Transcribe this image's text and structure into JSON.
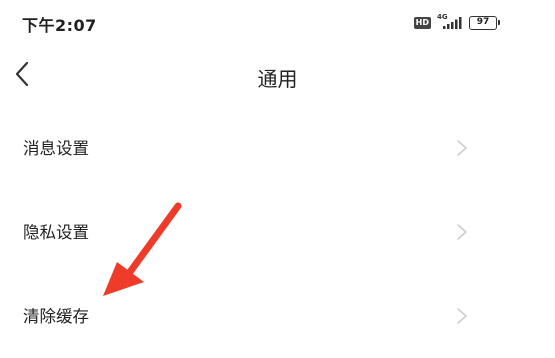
{
  "status_bar": {
    "time": "下午2:07",
    "hd_badge": "HD",
    "network_type": "4G",
    "battery_level": "97",
    "icons": [
      "hd-icon",
      "signal-icon",
      "battery-icon"
    ]
  },
  "nav": {
    "title": "通用",
    "back_icon": "chevron-left-icon"
  },
  "menu": {
    "items": [
      {
        "label": "消息设置",
        "icon": "chevron-right-icon"
      },
      {
        "label": "隐私设置",
        "icon": "chevron-right-icon"
      },
      {
        "label": "清除缓存",
        "icon": "chevron-right-icon"
      }
    ]
  },
  "annotation": {
    "icon": "arrow-pointer-icon",
    "color": "#ee3b2a"
  },
  "colors": {
    "background": "#ffffff",
    "text": "#222222",
    "chevron": "#cccccc"
  }
}
